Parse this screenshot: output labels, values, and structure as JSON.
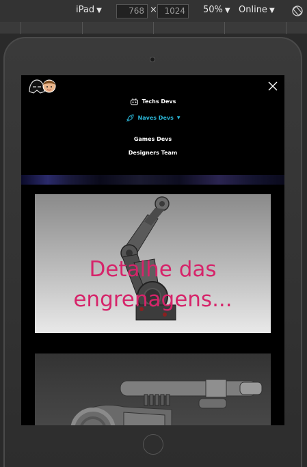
{
  "devtools": {
    "device": "iPad",
    "width": "768",
    "height": "1024",
    "dimension_separator": "×",
    "zoom": "50%",
    "network": "Online"
  },
  "site": {
    "nav": [
      {
        "label": "Techs Devs",
        "icon": "robot-icon",
        "active": false
      },
      {
        "label": "Naves Devs",
        "icon": "rocket-icon",
        "active": true,
        "has_dropdown": true
      },
      {
        "label": "Games Devs",
        "active": false
      },
      {
        "label": "Designers Team",
        "active": false
      }
    ],
    "gallery": [
      {
        "caption_line1": "Detalhe das",
        "caption_line2": "engrenagens..."
      },
      {
        "caption_line1": "",
        "caption_line2": ""
      }
    ]
  },
  "colors": {
    "active_nav": "#2ab5d6",
    "caption": "#d6246a",
    "screen_bg": "#000000"
  }
}
